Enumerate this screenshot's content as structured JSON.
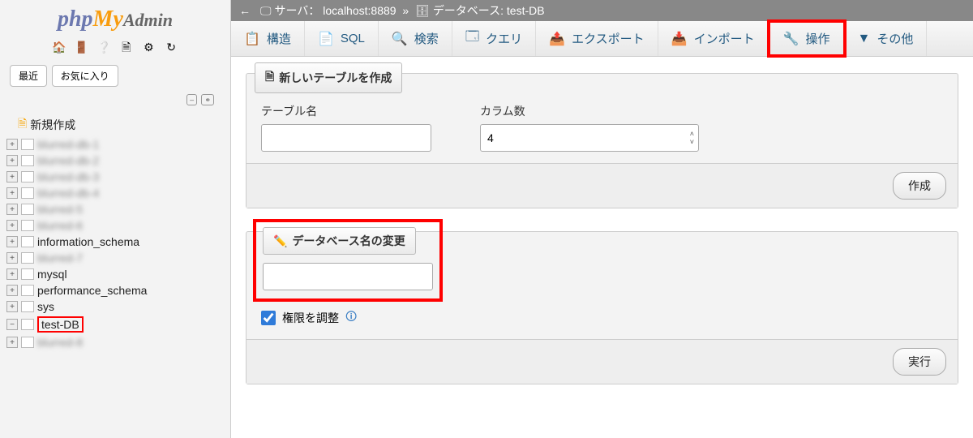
{
  "logo": {
    "p1": "php",
    "p2": "My",
    "p3": "Admin"
  },
  "sidebar": {
    "recent": "最近",
    "favorites": "お気に入り",
    "new_create": "新規作成",
    "items": [
      {
        "label": "blurred-db-1",
        "blurred": true
      },
      {
        "label": "blurred-db-2",
        "blurred": true
      },
      {
        "label": "blurred-db-3",
        "blurred": true
      },
      {
        "label": "blurred-db-4",
        "blurred": true
      },
      {
        "label": "blurred-5",
        "blurred": true
      },
      {
        "label": "blurred-6",
        "blurred": true
      },
      {
        "label": "information_schema",
        "blurred": false
      },
      {
        "label": "blurred-7",
        "blurred": true
      },
      {
        "label": "mysql",
        "blurred": false
      },
      {
        "label": "performance_schema",
        "blurred": false
      },
      {
        "label": "sys",
        "blurred": false
      },
      {
        "label": "test-DB",
        "blurred": false,
        "selected": true,
        "expanded": true
      },
      {
        "label": "blurred-8",
        "blurred": true
      }
    ]
  },
  "breadcrumb": {
    "server_label": "サーバ：",
    "server_value": "localhost:8889",
    "sep": "»",
    "db_label": "データベース:",
    "db_value": "test-DB"
  },
  "tabs": {
    "structure": "構造",
    "sql": "SQL",
    "search": "検索",
    "query": "クエリ",
    "export": "エクスポート",
    "import": "インポート",
    "operations": "操作",
    "more": "その他"
  },
  "create_table": {
    "legend": "新しいテーブルを作成",
    "name_label": "テーブル名",
    "columns_label": "カラム数",
    "columns_value": "4",
    "submit": "作成"
  },
  "rename_db": {
    "legend": "データベース名の変更",
    "value": "",
    "adjust_priv": "権限を調整",
    "submit": "実行"
  }
}
